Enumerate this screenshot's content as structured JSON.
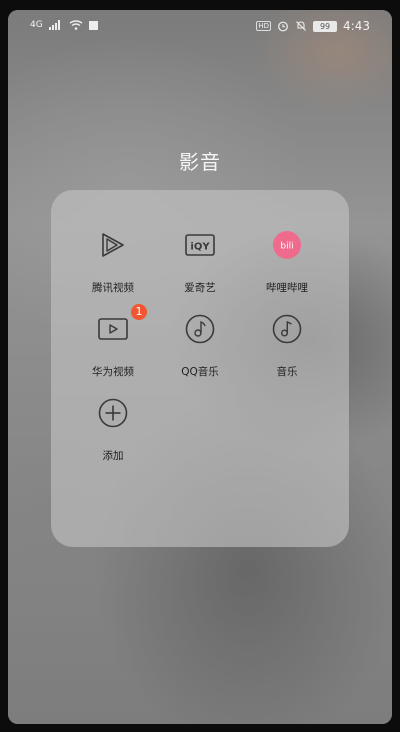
{
  "status_bar": {
    "signal_label": "4G",
    "battery": "99",
    "time": "4:43",
    "hd_label": "HD",
    "icons": [
      "signal-icon",
      "wifi-icon",
      "notification-square-icon",
      "hd-icon",
      "alarm-icon",
      "mute-icon",
      "battery-icon"
    ]
  },
  "folder": {
    "title": "影音",
    "apps": [
      {
        "label": "腾讯视频",
        "icon": "tencent-video-icon"
      },
      {
        "label": "爱奇艺",
        "icon": "iqiyi-icon",
        "icon_text": "iQY"
      },
      {
        "label": "哔哩哔哩",
        "icon": "bilibili-icon",
        "icon_text": "bili",
        "color": "#ef6b8e"
      },
      {
        "label": "华为视频",
        "icon": "huawei-video-icon",
        "badge": "1"
      },
      {
        "label": "QQ音乐",
        "icon": "qq-music-icon"
      },
      {
        "label": "音乐",
        "icon": "music-icon"
      },
      {
        "label": "添加",
        "icon": "add-icon"
      }
    ]
  },
  "colors": {
    "badge": "#f25630",
    "bilibili": "#ef6b8e",
    "folder_panel": "#c4c4c4"
  }
}
